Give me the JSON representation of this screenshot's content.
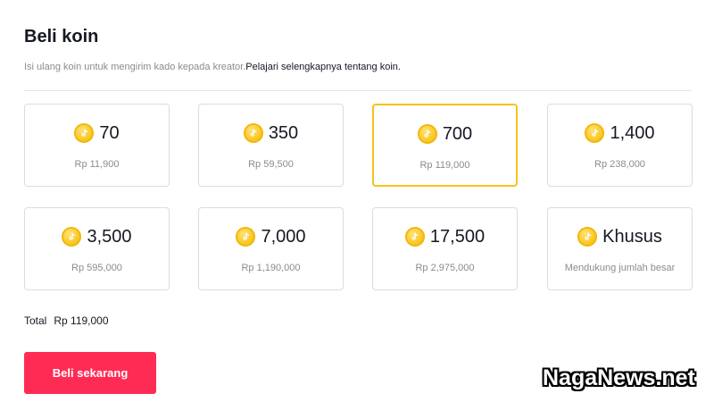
{
  "header": {
    "title": "Beli koin",
    "subtitle_text": "Isi ulang koin untuk mengirim kado kepada kreator.",
    "subtitle_link": "Pelajari selengkapnya tentang koin."
  },
  "packages": [
    {
      "amount": "70",
      "price": "Rp 11,900",
      "selected": false
    },
    {
      "amount": "350",
      "price": "Rp 59,500",
      "selected": false
    },
    {
      "amount": "700",
      "price": "Rp 119,000",
      "selected": true
    },
    {
      "amount": "1,400",
      "price": "Rp 238,000",
      "selected": false
    },
    {
      "amount": "3,500",
      "price": "Rp 595,000",
      "selected": false
    },
    {
      "amount": "7,000",
      "price": "Rp 1,190,000",
      "selected": false
    },
    {
      "amount": "17,500",
      "price": "Rp 2,975,000",
      "selected": false
    },
    {
      "amount": "Khusus",
      "price": "Mendukung jumlah besar",
      "selected": false
    }
  ],
  "total": {
    "label": "Total",
    "value": "Rp 119,000"
  },
  "buy_button_label": "Beli sekarang",
  "watermark": "NagaNews.net",
  "colors": {
    "accent": "#fe2c55",
    "selected_border": "#f5c31c",
    "coin": "#f9c928"
  },
  "icons": {
    "coin": "tiktok-coin-icon"
  }
}
